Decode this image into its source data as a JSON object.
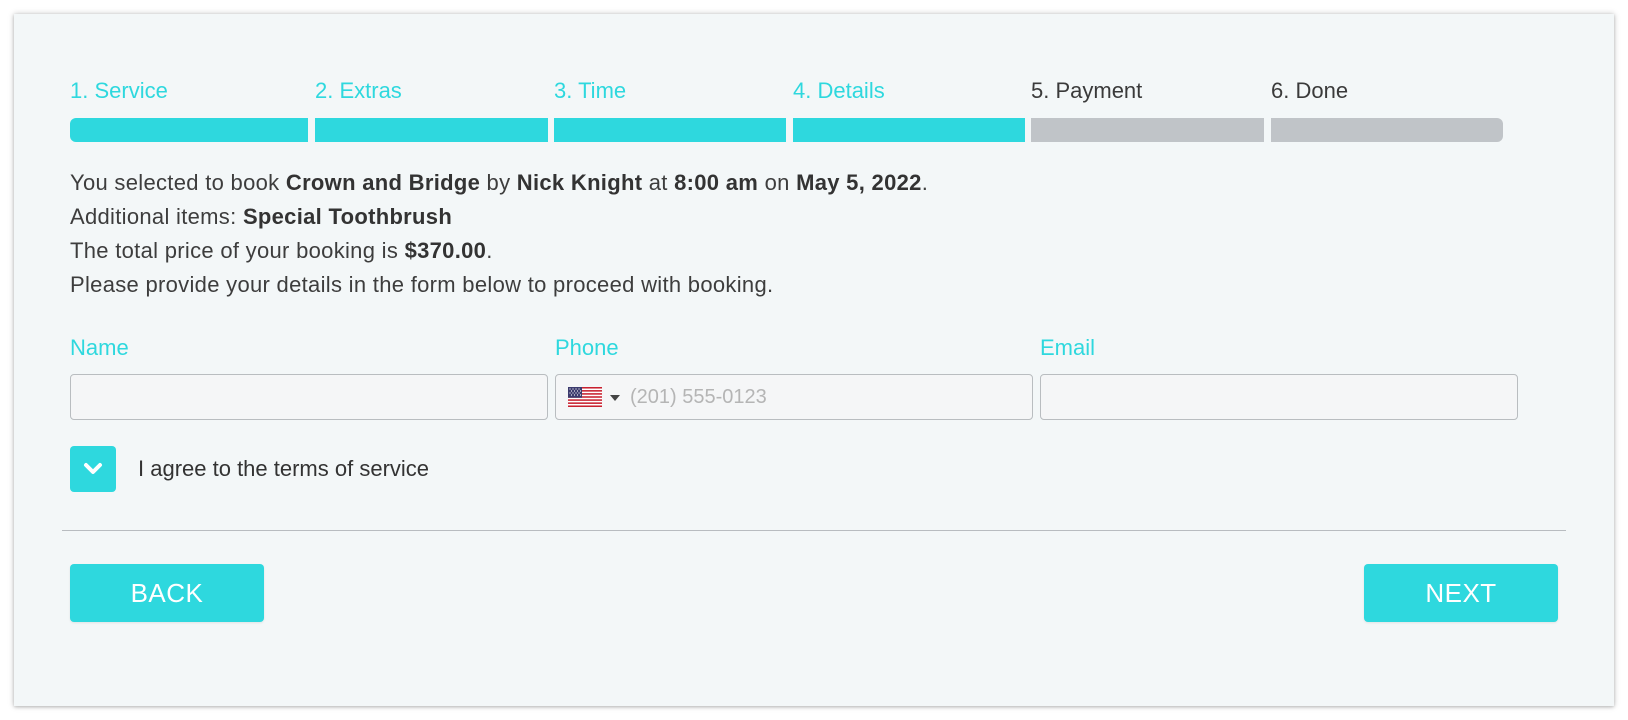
{
  "steps": [
    {
      "label": "1. Service",
      "state": "done"
    },
    {
      "label": "2. Extras",
      "state": "done"
    },
    {
      "label": "3. Time",
      "state": "done"
    },
    {
      "label": "4. Details",
      "state": "done"
    },
    {
      "label": "5. Payment",
      "state": "todo"
    },
    {
      "label": "6. Done",
      "state": "todo"
    }
  ],
  "summary": {
    "line1_prefix": "You selected to book ",
    "service": "Crown and Bridge",
    "by": " by ",
    "staff": "Nick Knight",
    "at": " at ",
    "time": "8:00 am",
    "on": " on ",
    "date": "May 5, 2022",
    "period": ".",
    "line2_prefix": "Additional items: ",
    "extras": "Special Toothbrush",
    "line3_prefix": "The total price of your booking is ",
    "price": "$370.00",
    "line3_suffix": ".",
    "line4": "Please provide your details in the form below to proceed with booking."
  },
  "form": {
    "name_label": "Name",
    "name_value": "",
    "phone_label": "Phone",
    "phone_placeholder": "(201) 555-0123",
    "phone_value": "",
    "phone_country_icon": "us-flag-icon",
    "email_label": "Email",
    "email_value": ""
  },
  "terms": {
    "checked": true,
    "label": "I agree to the terms of service"
  },
  "buttons": {
    "back": "BACK",
    "next": "NEXT"
  },
  "colors": {
    "accent": "#2ed8de",
    "inactive_bar": "#c0c4c8",
    "background": "#f3f7f8",
    "text": "#3d3d3d"
  }
}
